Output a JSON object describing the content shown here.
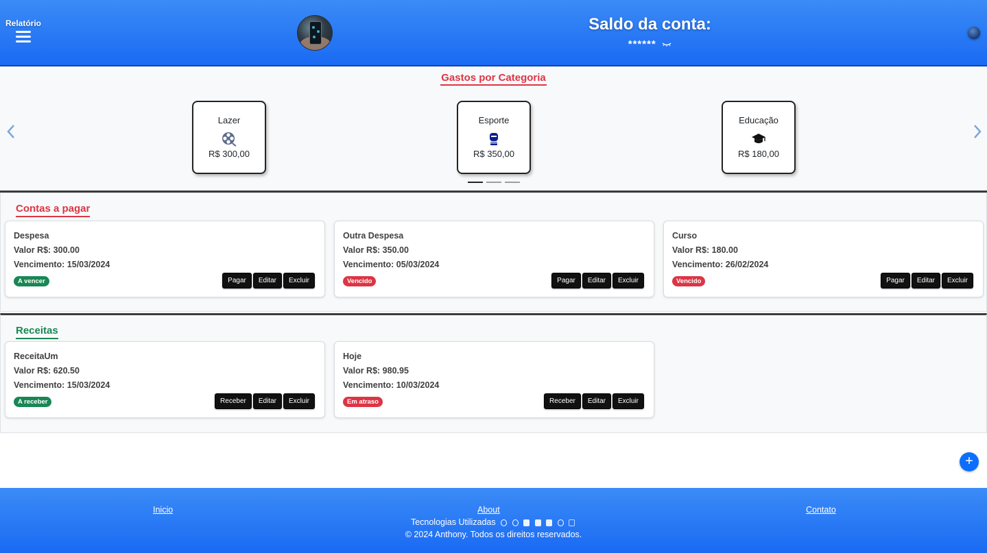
{
  "header": {
    "menu_label": "Relatório",
    "balance_title": "Saldo da conta:",
    "balance_value": "******"
  },
  "categories": {
    "title": "Gastos por Categoria",
    "items": [
      {
        "name": "Lazer",
        "icon": "film-reel-icon",
        "amount": "R$ 300,00"
      },
      {
        "name": "Esporte",
        "icon": "boxing-glove-icon",
        "amount": "R$ 350,00"
      },
      {
        "name": "Educação",
        "icon": "graduation-cap-icon",
        "amount": "R$ 180,00"
      }
    ],
    "active_slide": 1,
    "slide_count": 3
  },
  "bills": {
    "title": "Contas a pagar",
    "items": [
      {
        "name": "Despesa",
        "value": "Valor R$: 300.00",
        "due": "Vencimento: 15/03/2024",
        "status": "A vencer",
        "status_color": "#198754"
      },
      {
        "name": "Outra Despesa",
        "value": "Valor R$: 350.00",
        "due": "Vencimento: 05/03/2024",
        "status": "Vencido",
        "status_color": "#dc3545"
      },
      {
        "name": "Curso",
        "value": "Valor R$: 180.00",
        "due": "Vencimento: 26/02/2024",
        "status": "Vencido",
        "status_color": "#dc3545"
      }
    ],
    "buttons": {
      "pay": "Pagar",
      "edit": "Editar",
      "delete": "Excluir"
    }
  },
  "income": {
    "title": "Receitas",
    "items": [
      {
        "name": "ReceitaUm",
        "value": "Valor R$: 620.50",
        "due": "Vencimento: 15/03/2024",
        "status": "A receber",
        "status_color": "#198754"
      },
      {
        "name": "Hoje",
        "value": "Valor R$: 980.95",
        "due": "Vencimento: 10/03/2024",
        "status": "Em atraso",
        "status_color": "#dc3545"
      }
    ],
    "buttons": {
      "receive": "Receber",
      "edit": "Editar",
      "delete": "Excluir"
    }
  },
  "fab_label": "+",
  "footer": {
    "links": {
      "home": "Inicio",
      "about": "About",
      "contact": "Contato"
    },
    "tech_label": "Tecnologias Utilizadas",
    "tech_icons": [
      "react-icon",
      "vite-icon",
      "html5-icon",
      "css3-icon",
      "bootstrap-icon",
      "chart-icon",
      "calendar-icon"
    ],
    "copyright": "© 2024 Anthony. Todos os direitos reservados."
  },
  "colors": {
    "header_blue": "#1a6af3",
    "danger": "#dc3545",
    "success": "#198754",
    "primary": "#0d6efd"
  }
}
